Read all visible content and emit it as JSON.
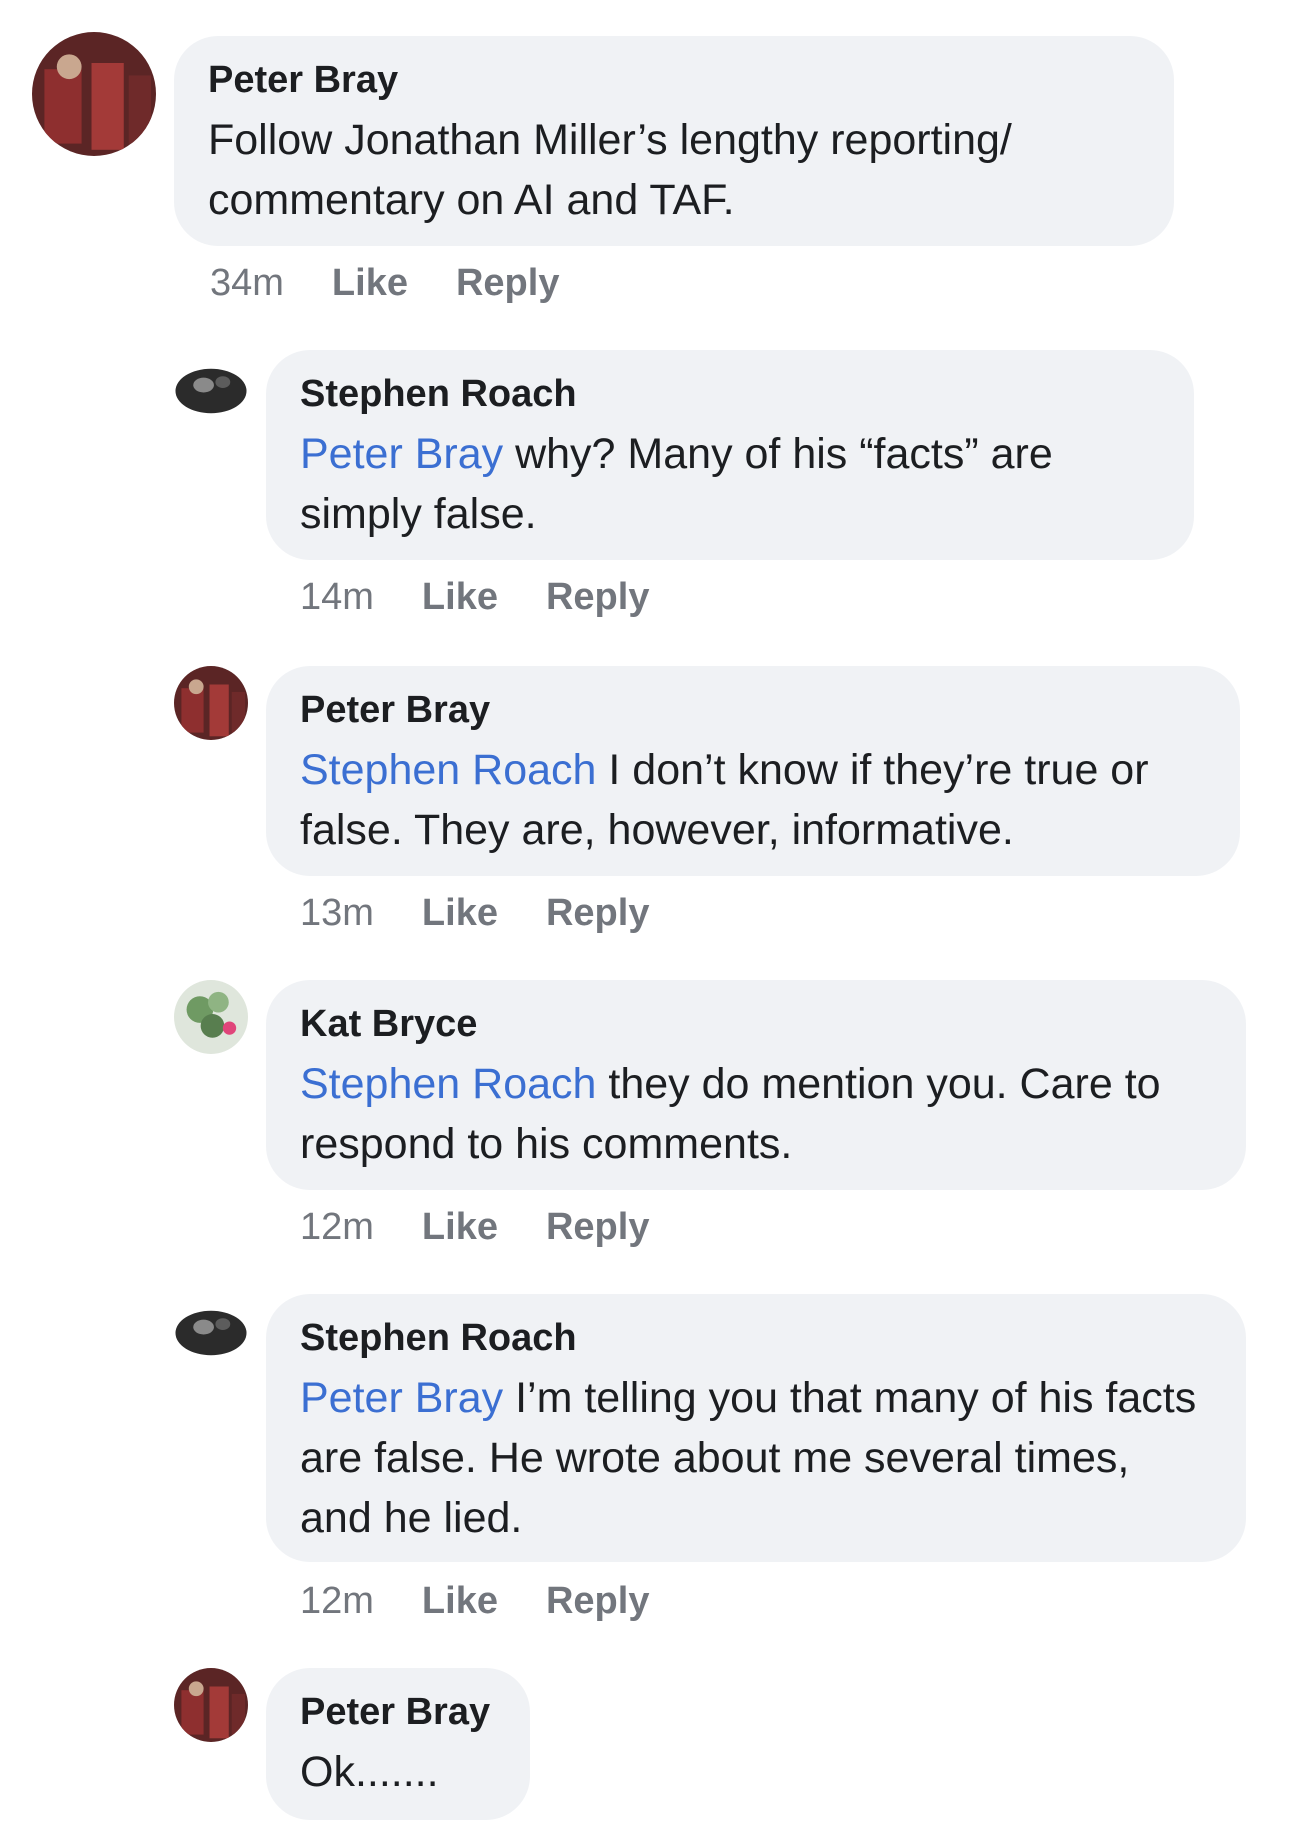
{
  "comments": [
    {
      "author": "Peter Bray",
      "mention": "",
      "text": "Follow Jonathan Miller’s lengthy reporting/ commentary on AI and TAF.",
      "time": "34m",
      "like": "Like",
      "reply": "Reply",
      "avatar": "peter-bray"
    },
    {
      "author": "Stephen Roach",
      "mention": "Peter Bray",
      "text": " why? Many of his “facts” are simply false.",
      "time": "14m",
      "like": "Like",
      "reply": "Reply",
      "avatar": "stephen-roach"
    },
    {
      "author": "Peter Bray",
      "mention": "Stephen Roach",
      "text": " I don’t know if they’re true or false. They are, however, informative.",
      "time": "13m",
      "like": "Like",
      "reply": "Reply",
      "avatar": "peter-bray"
    },
    {
      "author": "Kat Bryce",
      "mention": "Stephen Roach",
      "text": " they do mention you. Care to respond to his comments.",
      "time": "12m",
      "like": "Like",
      "reply": "Reply",
      "avatar": "kat-bryce"
    },
    {
      "author": "Stephen Roach",
      "mention": "Peter Bray",
      "text": " I’m telling you that many of his facts are false. He wrote about me several times, and he lied.",
      "time": "12m",
      "like": "Like",
      "reply": "Reply",
      "avatar": "stephen-roach"
    },
    {
      "author": "Peter Bray",
      "mention": "",
      "text": "Ok.......",
      "time": "",
      "like": "",
      "reply": "",
      "avatar": "peter-bray"
    }
  ],
  "colors": {
    "bubble": "#f0f2f5",
    "mention": "#3b6fd2",
    "meta": "#72767d"
  }
}
